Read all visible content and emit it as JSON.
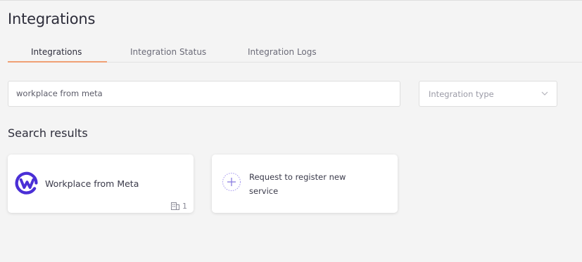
{
  "page": {
    "title": "Integrations"
  },
  "tabs": [
    {
      "label": "Integrations",
      "active": true
    },
    {
      "label": "Integration Status",
      "active": false
    },
    {
      "label": "Integration Logs",
      "active": false
    }
  ],
  "search": {
    "value": "workplace from meta"
  },
  "type_filter": {
    "placeholder": "Integration type"
  },
  "results": {
    "heading": "Search results",
    "cards": [
      {
        "name": "Workplace from Meta",
        "org_count": "1",
        "icon": "workplace-logo-icon"
      }
    ],
    "request_card": {
      "label": "Request to register new service",
      "icon": "plus-icon"
    }
  },
  "colors": {
    "accent_tab_indicator": "#f0a074",
    "workplace_brand": "#4a2fd6",
    "plus_circle": "#a79af0"
  }
}
